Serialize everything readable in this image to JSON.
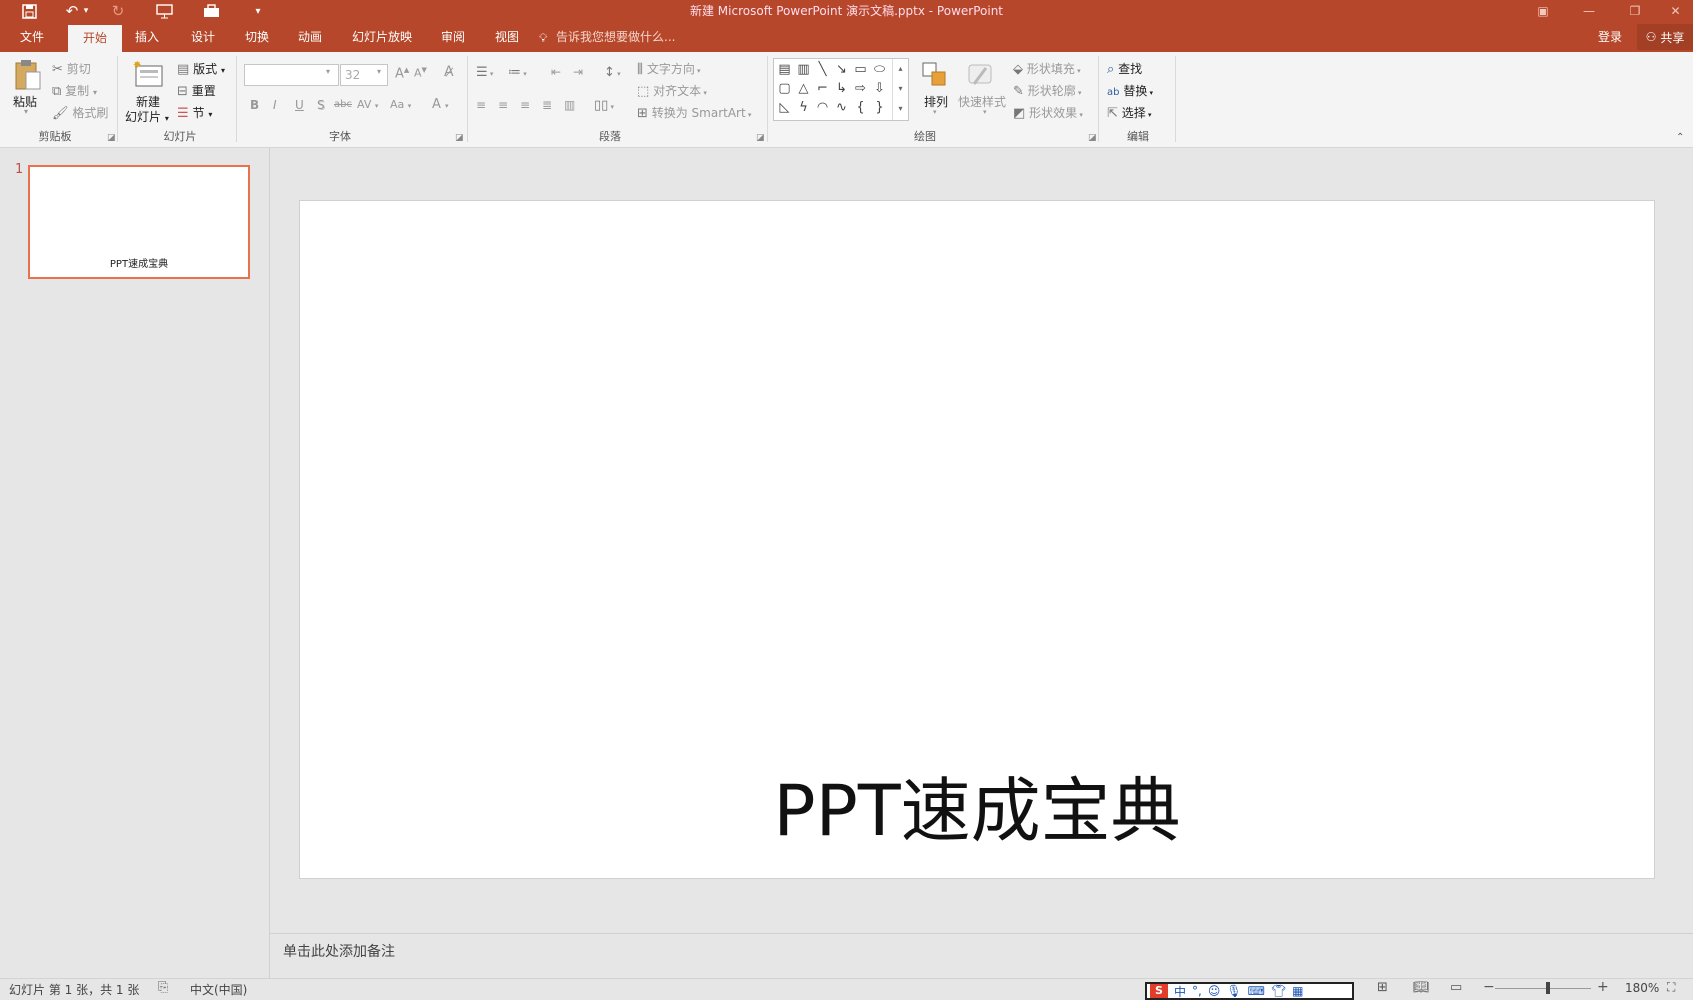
{
  "titlebar": {
    "doc_title": "新建 Microsoft PowerPoint 演示文稿.pptx - PowerPoint",
    "qat": [
      "save-icon",
      "undo-icon",
      "redo-icon",
      "present-from-start-icon",
      "toolbox-icon",
      "customize-qat-icon"
    ],
    "window_buttons": [
      "ribbon-display-icon",
      "minimize-icon",
      "restore-icon",
      "close-icon"
    ]
  },
  "tabs": {
    "file": "文件",
    "home": "开始",
    "insert": "插入",
    "design": "设计",
    "transitions": "切换",
    "animations": "动画",
    "slideshow": "幻灯片放映",
    "review": "审阅",
    "view": "视图",
    "tellme": "告诉我您想要做什么...",
    "signin": "登录",
    "share": "共享"
  },
  "ribbon": {
    "clipboard": {
      "group": "剪贴板",
      "paste": "粘贴",
      "cut": "剪切",
      "copy": "复制",
      "format_painter": "格式刷"
    },
    "slides": {
      "group": "幻灯片",
      "new_slide_1": "新建",
      "new_slide_2": "幻灯片",
      "layout": "版式",
      "reset": "重置",
      "section": "节"
    },
    "font": {
      "group": "字体",
      "font_name": "",
      "font_size": "32",
      "bold": "B",
      "italic": "I",
      "underline": "U",
      "shadow": "S",
      "strike": "abc",
      "spacing": "AV",
      "case": "Aa",
      "color": "A"
    },
    "paragraph": {
      "group": "段落",
      "text_direction": "文字方向",
      "align_text": "对齐文本",
      "smartart": "转换为 SmartArt"
    },
    "drawing": {
      "group": "绘图",
      "arrange": "排列",
      "quick_styles": "快速样式",
      "shape_fill": "形状填充",
      "shape_outline": "形状轮廓",
      "shape_effects": "形状效果"
    },
    "editing": {
      "group": "编辑",
      "find": "查找",
      "replace": "替换",
      "select": "选择"
    }
  },
  "slides_pane": {
    "number": "1",
    "thumb_title": "PPT速成宝典"
  },
  "slide": {
    "title": "PPT速成宝典"
  },
  "notes": {
    "placeholder": "单击此处添加备注"
  },
  "status": {
    "slide_info": "幻灯片 第 1 张，共 1 张",
    "language": "中文(中国)",
    "ime_label": "中",
    "zoom": "180%",
    "zoom_level": 0.55
  }
}
